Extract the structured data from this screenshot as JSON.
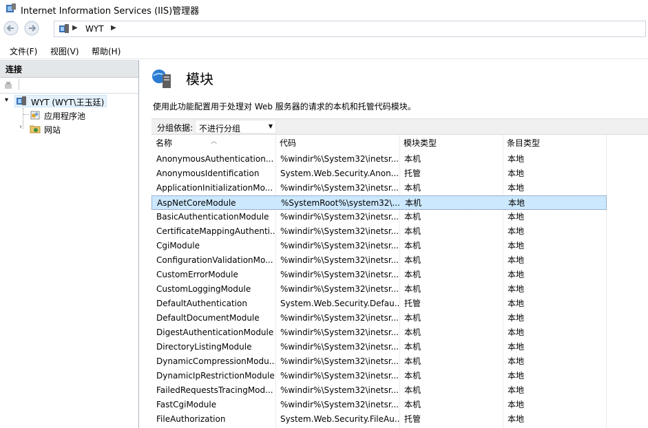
{
  "window": {
    "title": "Internet Information Services (IIS)管理器",
    "icon": "iis-app-icon"
  },
  "address_bar": {
    "node": "WYT",
    "back_icon": "back-arrow-icon",
    "forward_icon": "forward-arrow-icon"
  },
  "menu": {
    "items": [
      "文件(F)",
      "视图(V)",
      "帮助(H)"
    ]
  },
  "connections": {
    "title": "连接",
    "tree": {
      "root": "WYT (WYT\\王玉廷)",
      "children": [
        "应用程序池",
        "网站"
      ]
    }
  },
  "page": {
    "title": "模块",
    "description": "使用此功能配置用于处理对 Web 服务器的请求的本机和托管代码模块。",
    "group_by_label": "分组依据:",
    "group_by_value": "不进行分组"
  },
  "table": {
    "columns": [
      "名称",
      "代码",
      "模块类型",
      "条目类型"
    ],
    "rows": [
      [
        "AnonymousAuthentication...",
        "%windir%\\System32\\inetsr...",
        "本机",
        "本地"
      ],
      [
        "AnonymousIdentification",
        "System.Web.Security.Anon...",
        "托管",
        "本地"
      ],
      [
        "ApplicationInitializationMo...",
        "%windir%\\System32\\inetsr...",
        "本机",
        "本地"
      ],
      [
        "AspNetCoreModule",
        "%SystemRoot%\\system32\\...",
        "本机",
        "本地"
      ],
      [
        "BasicAuthenticationModule",
        "%windir%\\System32\\inetsr...",
        "本机",
        "本地"
      ],
      [
        "CertificateMappingAuthenti...",
        "%windir%\\System32\\inetsr...",
        "本机",
        "本地"
      ],
      [
        "CgiModule",
        "%windir%\\System32\\inetsr...",
        "本机",
        "本地"
      ],
      [
        "ConfigurationValidationMo...",
        "%windir%\\System32\\inetsr...",
        "本机",
        "本地"
      ],
      [
        "CustomErrorModule",
        "%windir%\\System32\\inetsr...",
        "本机",
        "本地"
      ],
      [
        "CustomLoggingModule",
        "%windir%\\System32\\inetsr...",
        "本机",
        "本地"
      ],
      [
        "DefaultAuthentication",
        "System.Web.Security.Defau...",
        "托管",
        "本地"
      ],
      [
        "DefaultDocumentModule",
        "%windir%\\System32\\inetsr...",
        "本机",
        "本地"
      ],
      [
        "DigestAuthenticationModule",
        "%windir%\\System32\\inetsr...",
        "本机",
        "本地"
      ],
      [
        "DirectoryListingModule",
        "%windir%\\System32\\inetsr...",
        "本机",
        "本地"
      ],
      [
        "DynamicCompressionModu...",
        "%windir%\\System32\\inetsr...",
        "本机",
        "本地"
      ],
      [
        "DynamicIpRestrictionModule",
        "%windir%\\System32\\inetsr...",
        "本机",
        "本地"
      ],
      [
        "FailedRequestsTracingMod...",
        "%windir%\\System32\\inetsr...",
        "本机",
        "本地"
      ],
      [
        "FastCgiModule",
        "%windir%\\System32\\inetsr...",
        "本机",
        "本地"
      ],
      [
        "FileAuthorization",
        "System.Web.Security.FileAu...",
        "托管",
        "本地"
      ]
    ],
    "selected_row": 3
  }
}
